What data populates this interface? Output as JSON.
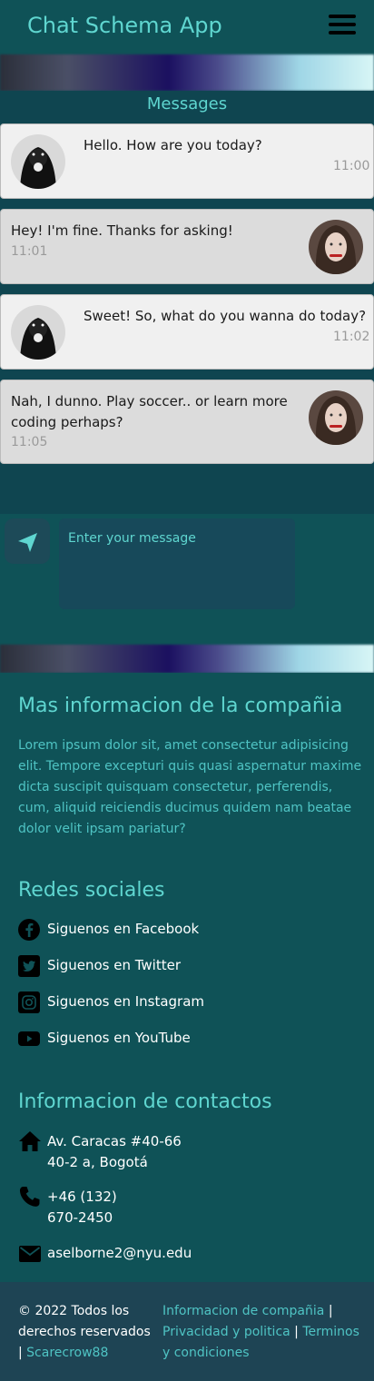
{
  "header": {
    "app_title": "Chat Schema App",
    "menu_icon": "hamburger-menu-icon"
  },
  "chat": {
    "title": "Messages",
    "messages": [
      {
        "side": "left",
        "text": "Hello. How are you today?",
        "time": "11:00"
      },
      {
        "side": "right",
        "text": "Hey! I'm fine. Thanks for asking!",
        "time": "11:01"
      },
      {
        "side": "left",
        "text": "Sweet! So, what do you wanna do today?",
        "time": "11:02"
      },
      {
        "side": "right",
        "text": "Nah, I dunno. Play soccer.. or learn more coding perhaps?",
        "time": "11:05"
      }
    ]
  },
  "composer": {
    "placeholder": "Enter your message",
    "send_icon": "paper-plane-icon"
  },
  "company": {
    "title": "Mas informacion de la compañia",
    "body": "Lorem ipsum dolor sit, amet consectetur adipisicing elit. Tempore excepturi quis quasi aspernatur maxime dicta suscipit quisquam consectetur, perferendis, cum, aliquid reiciendis ducimus quidem nam beatae dolor velit ipsam pariatur?"
  },
  "social": {
    "title": "Redes sociales",
    "items": [
      {
        "label": "Siguenos en Facebook",
        "icon": "facebook-icon"
      },
      {
        "label": "Siguenos en Twitter",
        "icon": "twitter-icon"
      },
      {
        "label": "Siguenos en Instagram",
        "icon": "instagram-icon"
      },
      {
        "label": "Siguenos en YouTube",
        "icon": "youtube-icon"
      }
    ]
  },
  "contacts": {
    "title": "Informacion de contactos",
    "address_line1": "Av. Caracas #40-66",
    "address_line2": "40-2 a, Bogotá",
    "phone_line1": "+46 (132)",
    "phone_line2": "670-2450",
    "email": "aselborne2@nyu.edu"
  },
  "footer": {
    "copyright": "© 2022 Todos los derechos reservados |",
    "author": "Scarecrow88",
    "link_company": "Informacion de compañia",
    "link_privacy": "Privacidad y politica",
    "link_terms": "Terminos y condiciones",
    "separator": "|"
  },
  "colors": {
    "accent": "#5fd6d0",
    "header_bg": "#0f5257",
    "footer_bg": "#1e4454"
  }
}
